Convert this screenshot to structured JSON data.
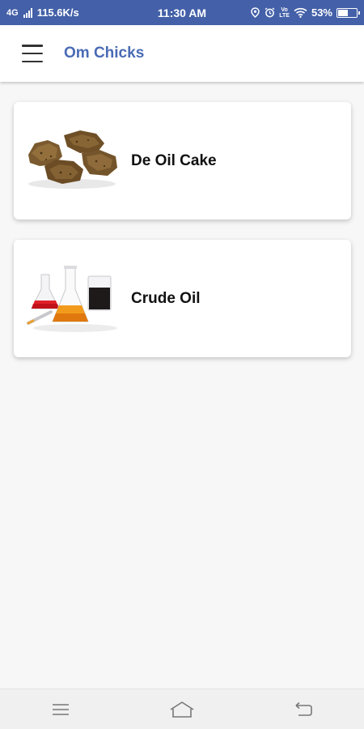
{
  "status_bar": {
    "network": "4G",
    "speed": "115.6K/s",
    "time": "11:30 AM",
    "volte_top": "Vo",
    "volte_bottom": "LTE",
    "battery": "53%"
  },
  "app_bar": {
    "title": "Om Chicks",
    "menu_icon": "hamburger-menu-icon"
  },
  "products": [
    {
      "label": "De Oil Cake",
      "image": "de-oil-cake-image"
    },
    {
      "label": "Crude Oil",
      "image": "crude-oil-flasks-image"
    }
  ],
  "nav_bar": {
    "icons": [
      "recent-apps-icon",
      "home-icon",
      "back-icon"
    ]
  },
  "colors": {
    "status_bar_bg": "#4360a8",
    "app_title": "#4a6bb5",
    "background": "#f7f7f7"
  }
}
